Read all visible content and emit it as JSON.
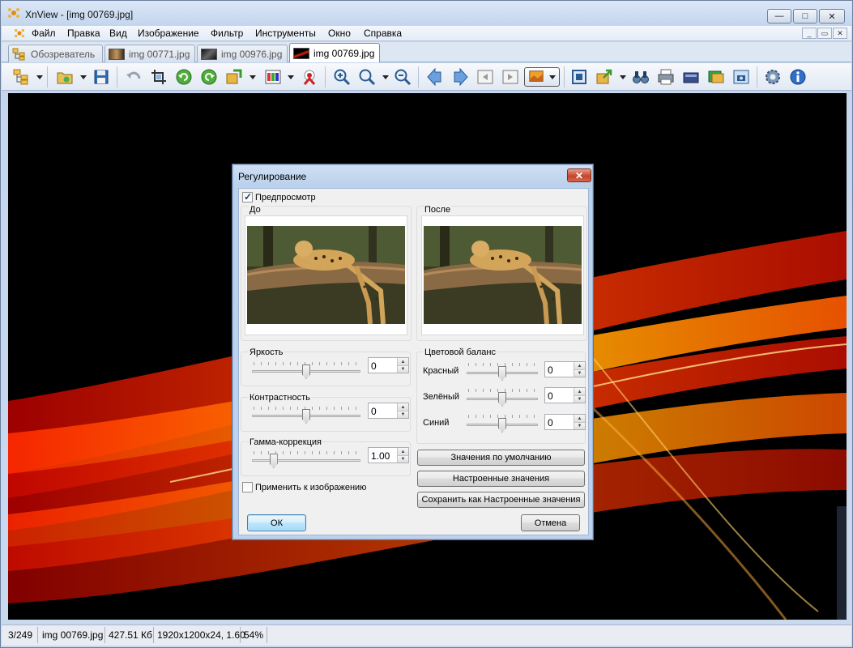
{
  "window": {
    "title": "XnView - [img 00769.jpg]",
    "controls": {
      "minimize": "—",
      "maximize": "□",
      "close": "✕"
    }
  },
  "menu": {
    "items": [
      "Файл",
      "Правка",
      "Вид",
      "Изображение",
      "Фильтр",
      "Инструменты",
      "Окно",
      "Справка"
    ],
    "mdi": [
      "_",
      "▭",
      "✕"
    ]
  },
  "tabs": [
    {
      "label": "Обозреватель",
      "active": false
    },
    {
      "label": "img 00771.jpg",
      "active": false
    },
    {
      "label": "img 00976.jpg",
      "active": false
    },
    {
      "label": "img 00769.jpg",
      "active": true
    }
  ],
  "toolbar": {
    "icons": [
      "browser-icon",
      "open-folder-icon",
      "save-icon",
      "undo-icon",
      "crop-icon",
      "rotate-left-icon",
      "rotate-right-icon",
      "convert-icon",
      "adjust-colors-icon",
      "red-eye-icon",
      "zoom-in-icon",
      "zoom-100-icon",
      "zoom-out-icon",
      "previous-icon",
      "next-icon",
      "first-icon",
      "last-icon",
      "view-mode-icon",
      "fit-icon",
      "export-icon",
      "binoculars-icon",
      "print-icon",
      "scanner-icon",
      "slideshow-icon",
      "capture-icon",
      "settings-icon",
      "info-icon"
    ]
  },
  "status": {
    "index": "3/249",
    "filename": "img 00769.jpg",
    "size": "427.51 Кб",
    "dimensions": "1920x1200x24, 1.60",
    "zoom": "54%"
  },
  "dialog": {
    "title": "Регулирование",
    "close": "✕",
    "preview_label": "Предпросмотр",
    "preview_checked": true,
    "before_label": "До",
    "after_label": "После",
    "brightness": {
      "label": "Яркость",
      "value": "0",
      "level": 0.5
    },
    "contrast": {
      "label": "Контрастность",
      "value": "0",
      "level": 0.5
    },
    "gamma": {
      "label": "Гамма-коррекция",
      "value": "1.00",
      "level": 0.2
    },
    "color_balance": {
      "label": "Цветовой баланс",
      "red": {
        "label": "Красный",
        "value": "0",
        "level": 0.5
      },
      "green": {
        "label": "Зелёный",
        "value": "0",
        "level": 0.5
      },
      "blue": {
        "label": "Синий",
        "value": "0",
        "level": 0.5
      }
    },
    "apply_label": "Применить к изображению",
    "apply_checked": false,
    "btn_defaults": "Значения по умолчанию",
    "btn_custom": "Настроенные значения",
    "btn_save_custom": "Сохранить как Настроенные значения",
    "btn_ok": "ОК",
    "btn_cancel": "Отмена"
  }
}
